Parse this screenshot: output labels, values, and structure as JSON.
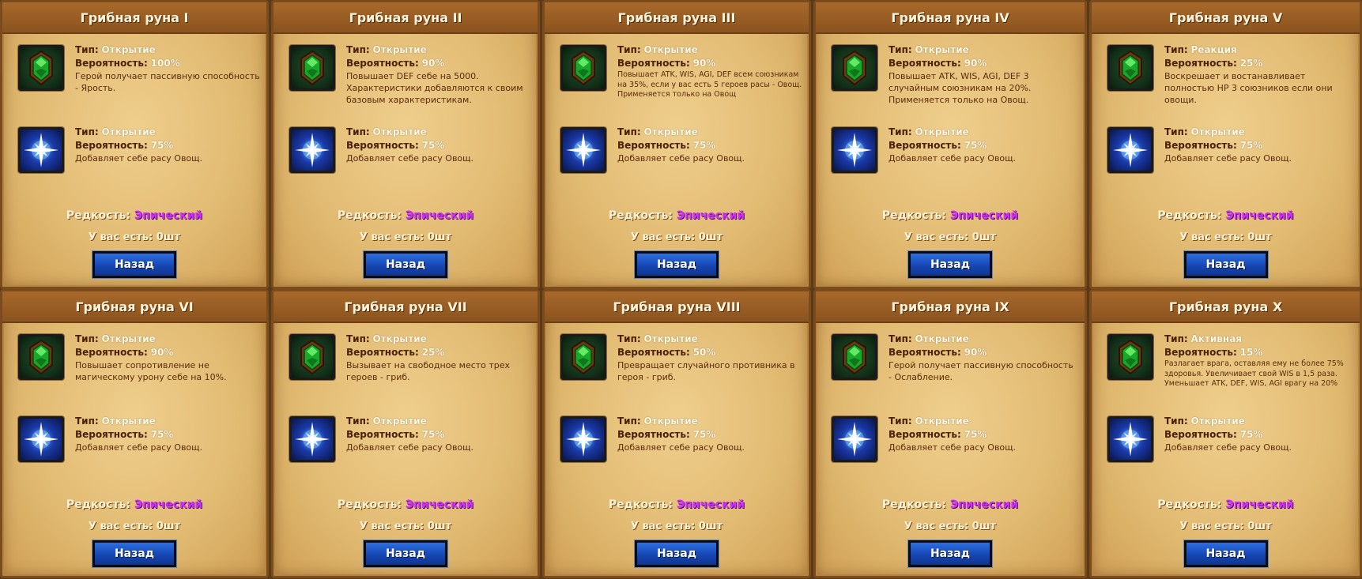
{
  "common": {
    "type_key": "Тип:",
    "prob_key": "Вероятность:",
    "rarity_key": "Редкость:",
    "rarity_value": "Эпический",
    "have_text": "У вас есть: 0шт",
    "back_label": "Назад"
  },
  "colors": {
    "rarity_epic": "#d22cff",
    "button_blue": "#1647b4",
    "parchment": "#e2bb73",
    "title_bar": "#8a531f"
  },
  "panels": [
    {
      "title": "Грибная руна I",
      "rune1": {
        "icon": "green-gem-icon",
        "type": "Открытие",
        "prob": "100%",
        "desc": "Герой получает пассивную способность - Ярость."
      },
      "rune2": {
        "icon": "blue-star-icon",
        "type": "Открытие",
        "prob": "75%",
        "desc": "Добавляет себе расу Овощ."
      }
    },
    {
      "title": "Грибная руна II",
      "rune1": {
        "icon": "green-gem-icon",
        "type": "Открытие",
        "prob": "90%",
        "desc": "Повышает DEF себе на 5000. Характеристики добавляются к своим базовым характеристикам."
      },
      "rune2": {
        "icon": "blue-star-icon",
        "type": "Открытие",
        "prob": "75%",
        "desc": "Добавляет себе расу Овощ."
      }
    },
    {
      "title": "Грибная руна III",
      "rune1": {
        "icon": "green-gem-icon",
        "type": "Открытие",
        "prob": "90%",
        "desc": "Повышает ATK, WIS, AGI, DEF всем союзникам на 35%, если у вас есть 5 героев расы - Овощ. Применяется только на Овощ"
      },
      "rune2": {
        "icon": "blue-star-icon",
        "type": "Открытие",
        "prob": "75%",
        "desc": "Добавляет себе расу Овощ."
      }
    },
    {
      "title": "Грибная руна IV",
      "rune1": {
        "icon": "green-gem-icon",
        "type": "Открытие",
        "prob": "90%",
        "desc": "Повышает ATK, WIS, AGI, DEF 3 случайным союзникам на 20%. Применяется только на Овощ."
      },
      "rune2": {
        "icon": "blue-star-icon",
        "type": "Открытие",
        "prob": "75%",
        "desc": "Добавляет себе расу Овощ."
      }
    },
    {
      "title": "Грибная руна V",
      "rune1": {
        "icon": "green-gem-icon",
        "type": "Реакция",
        "prob": "25%",
        "desc": "Воскрешает и востанавливает полностью HP 3 союзников если они овощи."
      },
      "rune2": {
        "icon": "blue-star-icon",
        "type": "Открытие",
        "prob": "75%",
        "desc": "Добавляет себе расу Овощ."
      }
    },
    {
      "title": "Грибная руна VI",
      "rune1": {
        "icon": "green-gem-icon",
        "type": "Открытие",
        "prob": "90%",
        "desc": "Повышает сопротивление не магическому урону себе на 10%."
      },
      "rune2": {
        "icon": "blue-star-icon",
        "type": "Открытие",
        "prob": "75%",
        "desc": "Добавляет себе расу Овощ."
      }
    },
    {
      "title": "Грибная руна VII",
      "rune1": {
        "icon": "green-gem-icon",
        "type": "Открытие",
        "prob": "25%",
        "desc": "Вызывает на свободное место трех героев - гриб."
      },
      "rune2": {
        "icon": "blue-star-icon",
        "type": "Открытие",
        "prob": "75%",
        "desc": "Добавляет себе расу Овощ."
      }
    },
    {
      "title": "Грибная руна VIII",
      "rune1": {
        "icon": "green-gem-icon",
        "type": "Открытие",
        "prob": "50%",
        "desc": "Превращает случайного противника в героя - гриб."
      },
      "rune2": {
        "icon": "blue-star-icon",
        "type": "Открытие",
        "prob": "75%",
        "desc": "Добавляет себе расу Овощ."
      }
    },
    {
      "title": "Грибная руна IX",
      "rune1": {
        "icon": "green-gem-icon",
        "type": "Открытие",
        "prob": "90%",
        "desc": "Герой получает пассивную способность - Ослабление."
      },
      "rune2": {
        "icon": "blue-star-icon",
        "type": "Открытие",
        "prob": "75%",
        "desc": "Добавляет себе расу Овощ."
      }
    },
    {
      "title": "Грибная руна X",
      "rune1": {
        "icon": "green-gem-icon",
        "type": "Активная",
        "prob": "15%",
        "desc": "Разлагает врага, оставляя ему не более 75% здоровья. Увеличивает свой WIS в 1,5 раза. Уменьшает ATK, DEF, WIS, AGI врагу на 20%"
      },
      "rune2": {
        "icon": "blue-star-icon",
        "type": "Открытие",
        "prob": "75%",
        "desc": "Добавляет себе расу Овощ."
      }
    }
  ]
}
